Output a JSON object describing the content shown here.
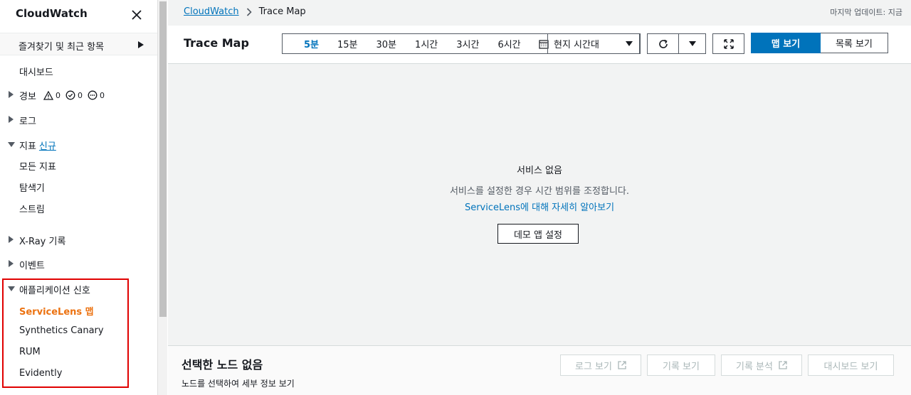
{
  "sidebar": {
    "title": "CloudWatch",
    "favorites": "즐겨찾기 및 최근 항목",
    "dashboard": "대시보드",
    "alarms": {
      "label": "경보",
      "alarm_count": "0",
      "ok_count": "0",
      "insufficient_count": "0"
    },
    "logs": "로그",
    "metrics": {
      "label": "지표",
      "new_badge": "신규"
    },
    "all_metrics": "모든 지표",
    "explorer": "탐색기",
    "streams": "스트림",
    "xray": "X-Ray 기록",
    "events": "이벤트",
    "app_signals": "애플리케이션 신호",
    "servicelens": "ServiceLens 맵",
    "synthetics": "Synthetics Canary",
    "rum": "RUM",
    "evidently": "Evidently"
  },
  "breadcrumb": {
    "root": "CloudWatch",
    "current": "Trace Map"
  },
  "last_updated": "마지막 업데이트: 지금",
  "header": {
    "title": "Trace Map",
    "time_options": [
      "5분",
      "15분",
      "30분",
      "1시간",
      "3시간",
      "6시간"
    ],
    "selected_time": "5분",
    "timezone": "현지 시간대",
    "view_map": "맵 보기",
    "view_list": "목록 보기"
  },
  "empty": {
    "title": "서비스 없음",
    "description": "서비스를 설정한 경우 시간 범위를 조정합니다.",
    "link_part1": "ServiceLens",
    "link_part2": "에 대해 자세히 알아보기",
    "demo_button": "데모 앱 설정"
  },
  "bottom": {
    "title": "선택한 노드 없음",
    "description": "노드를 선택하여 세부 정보 보기",
    "view_logs": "로그 보기",
    "view_traces": "기록 보기",
    "analyze_traces": "기록 분석",
    "view_dashboard": "대시보드 보기"
  },
  "colors": {
    "accent": "#0073bb",
    "active": "#ec7211",
    "highlight": "#e00000"
  }
}
